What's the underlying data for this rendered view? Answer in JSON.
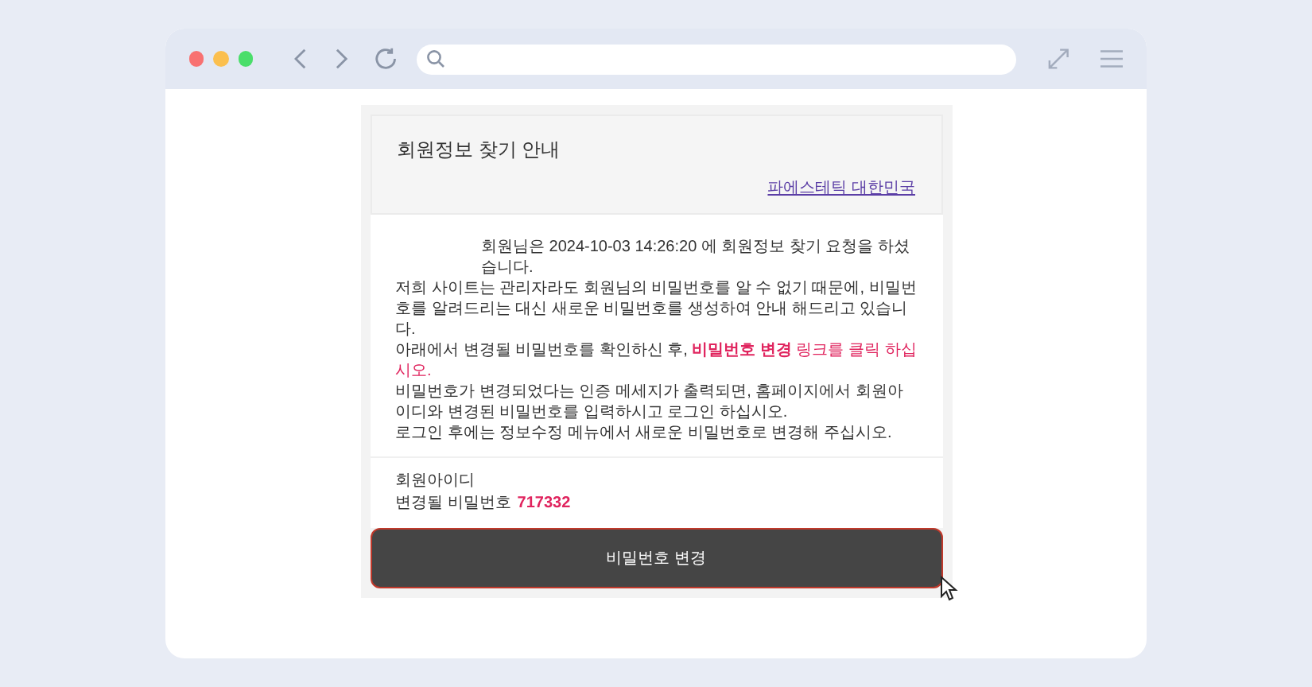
{
  "email": {
    "title": "회원정보 찾기 안내",
    "sender_link": "파에스테틱 대한민국",
    "paragraphs": [
      {
        "text": "회원님은 2024-10-03 14:26:20 에 회원정보 찾기 요청을 하셨습니다.",
        "indent": true
      },
      {
        "text": "저희 사이트는 관리자라도 회원님의 비밀번호를 알 수 없기 때문에, 비밀번호를 알려드리는 대신 새로운 비밀번호를 생성하여 안내 해드리고 있습니다.",
        "indent": false
      },
      {
        "text": "아래에서 변경될 비밀번호를 확인하신 후, ",
        "emphasis": "**비밀번호 변경** 링크를 클릭 하십시오.",
        "indent": false
      },
      {
        "text": "비밀번호가 변경되었다는 인증 메세지가 출력되면, 홈페이지에서 회원아이디와 변경된 비밀번호를 입력하시고 로그인 하십시오.",
        "indent": false
      },
      {
        "text": "로그인 후에는 정보수정 메뉴에서 새로운 비밀번호로 변경해 주십시오.",
        "indent": false
      }
    ],
    "member_id_label": "회원아이디",
    "password_label": "변경될 비밀번호",
    "password_value": "717332",
    "button": "비밀번호 변경"
  }
}
